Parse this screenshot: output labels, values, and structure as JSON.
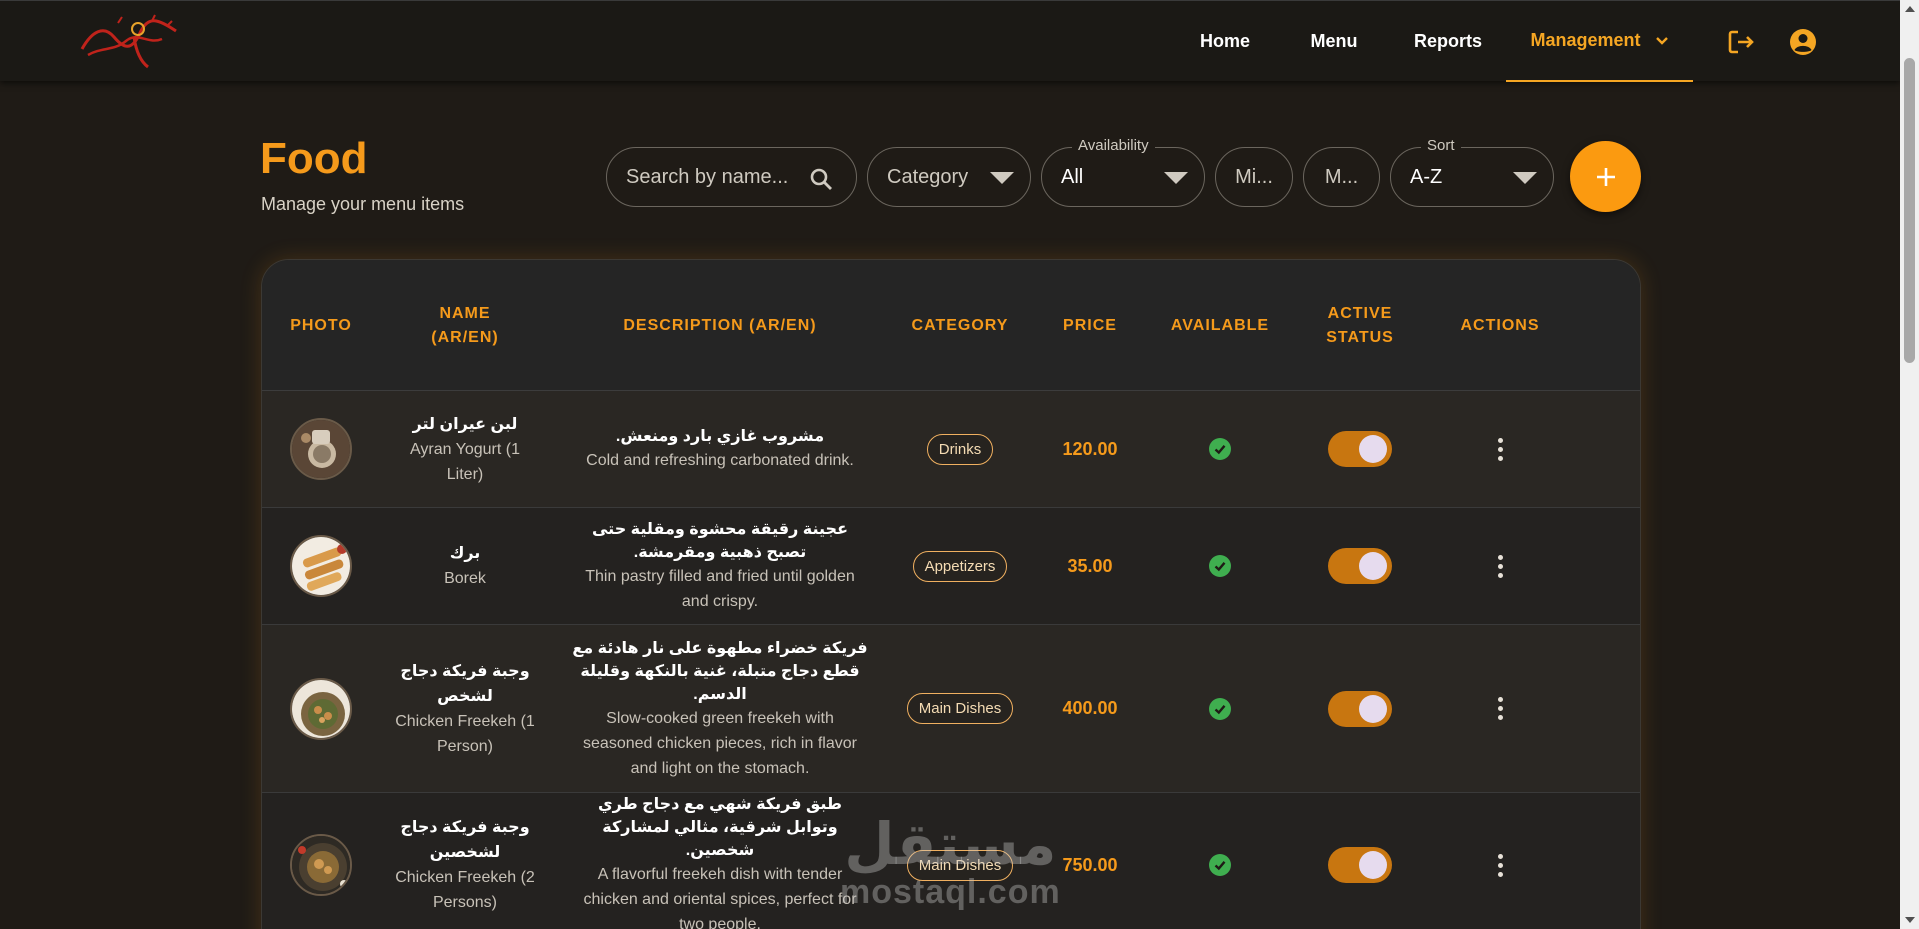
{
  "nav": {
    "items": [
      "Home",
      "Menu",
      "Reports",
      "Management"
    ],
    "active": "Management"
  },
  "header": {
    "title": "Food",
    "subtitle": "Manage your menu items"
  },
  "filters": {
    "search_placeholder": "Search by name...",
    "category_placeholder": "Category",
    "availability_label": "Availability",
    "availability_value": "All",
    "min_placeholder": "Mi...",
    "max_placeholder": "M...",
    "sort_label": "Sort",
    "sort_value": "A-Z",
    "add_label": "+"
  },
  "table": {
    "headers": [
      "PHOTO",
      "NAME\n(AR/EN)",
      "DESCRIPTION (AR/EN)",
      "CATEGORY",
      "PRICE",
      "AVAILABLE",
      "ACTIVE\nSTATUS",
      "ACTIONS"
    ],
    "rows": [
      {
        "name_ar": "لبن عيران لتر",
        "name_en": "Ayran Yogurt (1 Liter)",
        "desc_ar": "مشروب غازي بارد ومنعش.",
        "desc_en": "Cold and refreshing carbonated drink.",
        "category": "Drinks",
        "price": "120.00",
        "available": true,
        "active": true
      },
      {
        "name_ar": "برك",
        "name_en": "Borek",
        "desc_ar": "عجينة رقيقة محشوة ومقلية حتى تصبح ذهبية ومقرمشة.",
        "desc_en": "Thin pastry filled and fried until golden and crispy.",
        "category": "Appetizers",
        "price": "35.00",
        "available": true,
        "active": true
      },
      {
        "name_ar": "وجبة فريكة دجاج لشخص",
        "name_en": "Chicken Freekeh (1 Person)",
        "desc_ar": "فريكة خضراء مطهوة على نار هادئة مع قطع دجاج متبلة، غنية بالنكهة وقليلة الدسم.",
        "desc_en": "Slow-cooked green freekeh with seasoned chicken pieces, rich in flavor and light on the stomach.",
        "category": "Main Dishes",
        "price": "400.00",
        "available": true,
        "active": true
      },
      {
        "name_ar": "وجبة فريكة دجاج لشخصين",
        "name_en": "Chicken Freekeh (2 Persons)",
        "desc_ar": "طبق فريكة شهي مع دجاج طري وتوابل شرقية، مثالي لمشاركة شخصين.",
        "desc_en": "A flavorful freekeh dish with tender chicken and oriental spices, perfect for two people.",
        "category": "Main Dishes",
        "price": "750.00",
        "available": true,
        "active": true
      }
    ]
  },
  "watermark": {
    "ar": "مستقل",
    "en": "mostaql.com"
  },
  "colors": {
    "accent": "#f59a1b",
    "background": "#1f1b16",
    "toggle_on": "#c87610",
    "check": "#3fae4f"
  }
}
